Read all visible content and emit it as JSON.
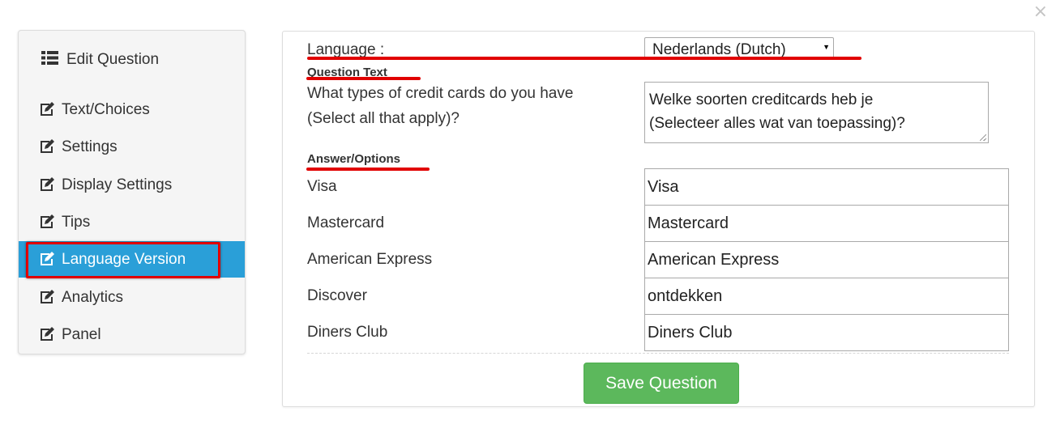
{
  "dialog": {
    "close_symbol": "×"
  },
  "sidebar": {
    "header": "Edit Question",
    "header_icon": "list-icon",
    "items": [
      {
        "label": "Text/Choices",
        "icon": "edit-icon"
      },
      {
        "label": "Settings",
        "icon": "edit-icon"
      },
      {
        "label": "Display Settings",
        "icon": "edit-icon"
      },
      {
        "label": "Tips",
        "icon": "edit-icon"
      },
      {
        "label": "Language Version",
        "icon": "edit-icon",
        "active": true
      },
      {
        "label": "Analytics",
        "icon": "edit-icon"
      },
      {
        "label": "Panel",
        "icon": "edit-icon"
      }
    ]
  },
  "form": {
    "language_label": "Language :",
    "language_value": "Nederlands (Dutch)",
    "question_section_title": "Question Text",
    "question_original_line1": "What types of credit cards do you have",
    "question_original_line2": "(Select all that apply)?",
    "question_translation_line1": "Welke soorten creditcards heb je",
    "question_translation_line2": "(Selecteer alles wat van toepassing)?",
    "answers_section_title": "Answer/Options",
    "answers": [
      {
        "original": "Visa",
        "translation": "Visa"
      },
      {
        "original": "Mastercard",
        "translation": "Mastercard"
      },
      {
        "original": "American Express",
        "translation": "American Express"
      },
      {
        "original": "Discover",
        "translation": "ontdekken"
      },
      {
        "original": "Diners Club",
        "translation": "Diners Club"
      }
    ],
    "save_label": "Save Question"
  },
  "colors": {
    "active_nav": "#2a9fd8",
    "annotation_red": "#e10000",
    "save_button": "#5cb85c"
  }
}
